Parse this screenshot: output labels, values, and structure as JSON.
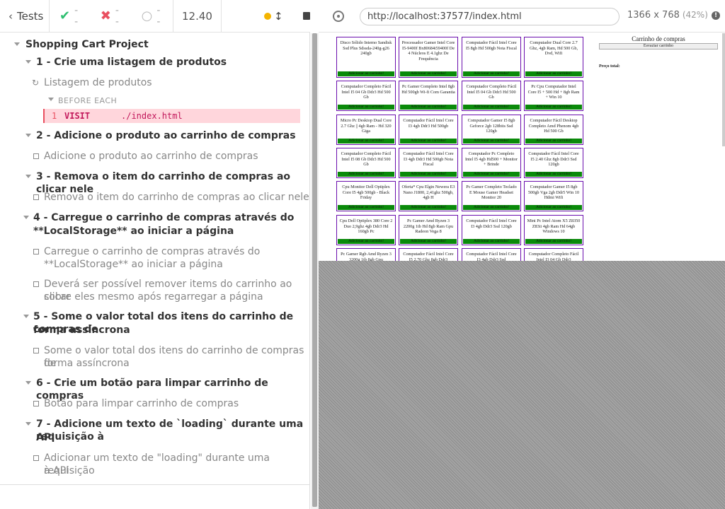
{
  "header": {
    "tests_label": "Tests",
    "passed": "--",
    "failed": "--",
    "pending": "--",
    "duration": "12.40"
  },
  "reporter": {
    "spec_title": "Shopping Cart Project",
    "suites": [
      {
        "title": "1 - Crie uma listagem de produtos",
        "tests": [
          "Listagem de produtos"
        ]
      },
      {
        "title": "2 - Adicione o produto ao carrinho de compras",
        "tests": [
          "Adicione o produto ao carrinho de compras"
        ]
      },
      {
        "title": "3 - Remova o item do carrinho de compras ao clicar nele",
        "tests": [
          "Remova o item do carrinho de compras ao clicar nele"
        ]
      },
      {
        "title": "4 - Carregue o carrinho de compras através do",
        "title2": "**LocalStorage** ao iniciar a página",
        "tests": [
          {
            "l1": "Carregue o carrinho de compras através do",
            "l2": "**LocalStorage** ao iniciar a página"
          },
          {
            "l1": "Deverá ser possível remover items do carrinho ao clicar",
            "l2": "sobre eles mesmo após regarregar a página"
          }
        ]
      },
      {
        "title": "5 - Some o valor total dos itens do carrinho de compras de",
        "title2": "forma assíncrona",
        "tests": [
          {
            "l1": "Some o valor total dos itens do carrinho de compras de",
            "l2": "forma assíncrona"
          }
        ]
      },
      {
        "title": "6 - Crie um botão para limpar carrinho de compras",
        "tests": [
          "Botão para limpar carrinho de compras"
        ]
      },
      {
        "title": "7 - Adicione um texto de `loading` durante uma requisição à",
        "title2": "API",
        "tests": [
          {
            "l1": "Adicionar um texto de \"loading\" durante uma requisição",
            "l2": "à API"
          }
        ]
      }
    ],
    "hook": {
      "label": "BEFORE EACH",
      "command_number": "1",
      "command_name": "VISIT",
      "command_message": "./index.html"
    }
  },
  "aut": {
    "url": "http://localhost:37577/index.html",
    "viewport": "1366 x 768",
    "scale": "(42%)",
    "cart_title": "Carrinho de compras",
    "empty_cart_button": "Esvaziar carrinho",
    "total_label": "Preço total:",
    "add_label": "Adicionar ao carrinho!",
    "products": [
      "Disco Sólido Interno Sandisk Ssd Plus Sdssda-240g-g26 240gb",
      "Processador Gamer Intel Core I5-9400f Bx80684i59400f De 4 Núcleos E 4.1ghz De Frequência",
      "Computador Fácil Intel Core I5 8gb Hd 500gb Nota Fiscal",
      "Computador Dual Core 2.7 Ghz, 4gb Ram, Hd 500 Gb, Dvd, Wifi",
      "Computador Completo Fácil Intel I5 04 Gb Ddr3 Hd 500 Gb",
      "Pc Gamer Completo Intel 8gb Hd 500gb Wi-fi Com Garantia",
      "Computador Completo Fácil Intel I5 04 Gb Ddr3 Hd 500 Gb",
      "Pc Cpu Computador Intel Core I5 + 500 Hd + 8gb Ram + Win 10",
      "Micro Pc Desktop Dual Core 2.7 Ghz || 4gb Ram - Hd 320 Giga",
      "Computador Fácil Intel Core I3 4gb Ddr3 Hd 500gb",
      "Computador Gamer I5 8gb Geforce 2gb 128bits Ssd 120gb",
      "Computador Fácil Desktop Completo Amd Phenom 4gb Hd 500 Gb",
      "Computador Completo Fácil Intel I5 08 Gb Ddr3 Hd 500 Gb",
      "Computador Fácil Intel Core I3 4gb Ddr3 Hd 500gb Nota Fiscal",
      "Computador Pc Completo Intel I5 4gb Hd500 + Monitor + Brinde",
      "Computador Fácil Intel Core I5 2.40 Ghz 8gb Ddr3 Ssd 120gb",
      "Cpu Monitor Dell Optiplex Core I5 4gb 500gb - Black Friday",
      "Oferta* Cpu Elgin Newera E3 Nano J1800, 2,41ghz 500gb, 4gb H",
      "Pc Gamer Completo Teclado E Mouse Gamer Headset Monitor 20",
      "Computador Gamer I5 8gb 500gb Vga 2gb Ddr5 Win 10 Hdmi Wifi",
      "Cpu Dell Optiplex 380 Core 2 Duo 2,9ghz 4gb Ddr3 Hd 160gb Pc",
      "Pc Gamer Amd Ryzen 3 2200g 1tb Hd 8gb Ram Gpu Radeon Vega 8",
      "Computador Fácil Intel Core I3 4gb Ddr3 Ssd 120gb",
      "Mini Pc Intel Atom X5 Z8350 Z83ii 4gb Ram Hd 64gb Windows 10",
      "Pc Gamer Rgb Amd Ryzen 3 3200g 1tb 8gb Gpu",
      "Computador Fácil Intel Core I5 2.70 Ghz 8gb Ddr3",
      "Computador Fácil Intel Core I3 4gb Ddr3 Ssd",
      "Computador Completo Fácil Intel I3 04 Gb Ddr3"
    ]
  },
  "colors": {
    "pass": "#2fbf71",
    "fail": "#e94f5f",
    "running": "#f4b400",
    "product_border": "#6a0dad",
    "add_button": "#0a8a0a"
  }
}
